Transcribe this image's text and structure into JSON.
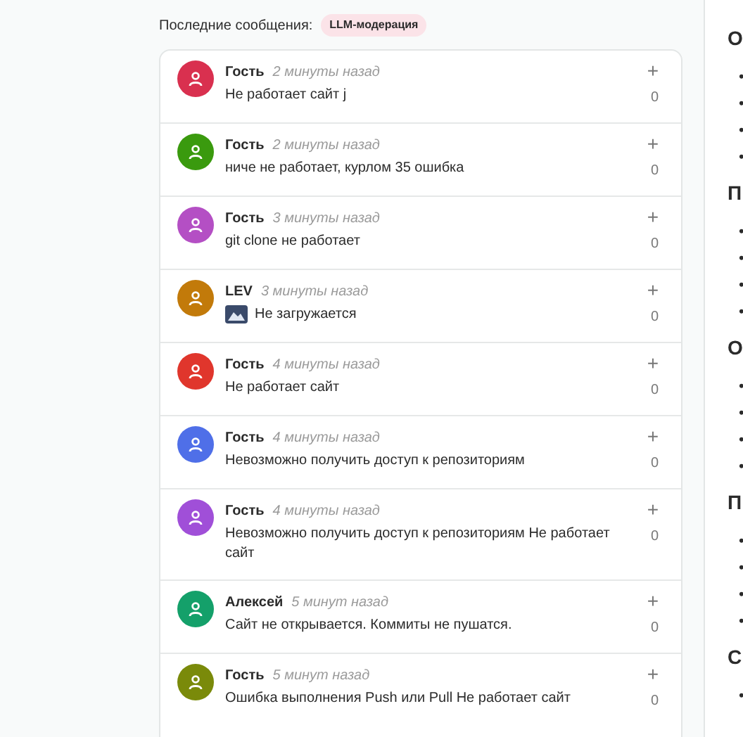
{
  "feed": {
    "title": "Последние сообщения:",
    "badge": "LLM-модерация",
    "messages": [
      {
        "author": "Гость",
        "time": "2 минуты назад",
        "text": "Не работает сайт j",
        "image": false,
        "votes": "0",
        "plus": "+",
        "color": "#d9304f"
      },
      {
        "author": "Гость",
        "time": "2 минуты назад",
        "text": "ниче не работает, курлом 35 ошибка",
        "image": false,
        "votes": "0",
        "plus": "+",
        "color": "#3a9a0e"
      },
      {
        "author": "Гость",
        "time": "3 минуты назад",
        "text": "git clone не работает",
        "image": false,
        "votes": "0",
        "plus": "+",
        "color": "#b44fc4"
      },
      {
        "author": "LEV",
        "time": "3 минуты назад",
        "text": "Не загружается",
        "image": true,
        "votes": "0",
        "plus": "+",
        "color": "#c27a0a"
      },
      {
        "author": "Гость",
        "time": "4 минуты назад",
        "text": "Не работает сайт",
        "image": false,
        "votes": "0",
        "plus": "+",
        "color": "#e0362c"
      },
      {
        "author": "Гость",
        "time": "4 минуты назад",
        "text": "Невозможно получить доступ к репозиториям",
        "image": false,
        "votes": "0",
        "plus": "+",
        "color": "#4f6fe8"
      },
      {
        "author": "Гость",
        "time": "4 минуты назад",
        "text": "Невозможно получить доступ к репозиториям Не работает сайт",
        "image": false,
        "votes": "0",
        "plus": "+",
        "color": "#a04fd8"
      },
      {
        "author": "Алексей",
        "time": "5 минут назад",
        "text": "Сайт не открывается. Коммиты не пушатся.",
        "image": false,
        "votes": "0",
        "plus": "+",
        "color": "#14a06a"
      },
      {
        "author": "Гость",
        "time": "5 минут назад",
        "text": "Ошибка выполнения Push или Pull Не работает сайт",
        "image": false,
        "votes": "0",
        "plus": "+",
        "color": "#7a8a0a"
      }
    ]
  },
  "side": {
    "sections": [
      {
        "heading": "О",
        "bullets": [
          "•",
          "•",
          "•",
          "•"
        ]
      },
      {
        "heading": "П",
        "bullets": [
          "•",
          "•",
          "•",
          "•"
        ]
      },
      {
        "heading": "О",
        "bullets": [
          "•",
          "•",
          "•",
          "•"
        ]
      },
      {
        "heading": "П",
        "bullets": [
          "•",
          "•",
          "•",
          "•"
        ]
      },
      {
        "heading": "С",
        "bullets": [
          "•"
        ]
      }
    ]
  }
}
